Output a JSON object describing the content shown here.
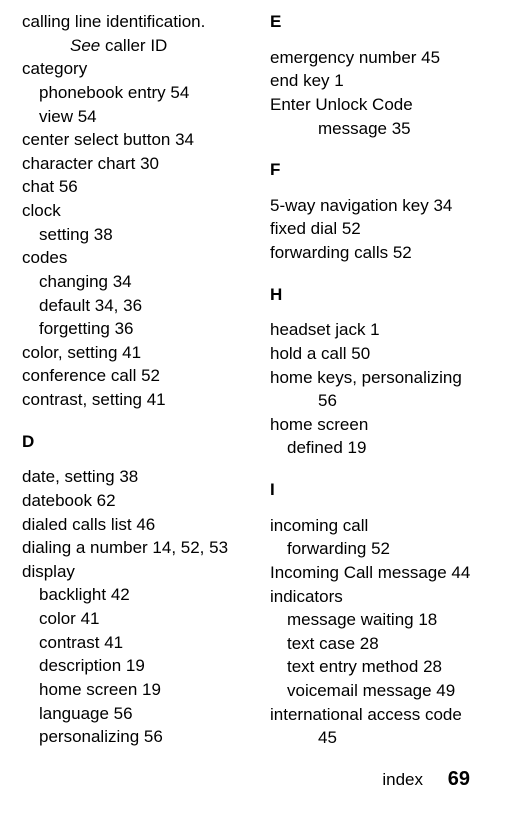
{
  "left": {
    "l01": "calling line identification.",
    "l02_prefix": "See",
    "l02_rest": " caller ID",
    "l03": "category",
    "l04": "phonebook entry  54",
    "l05": "view  54",
    "l06": "center select button  34",
    "l07": "character chart  30",
    "l08": "chat  56",
    "l09": "clock",
    "l10": "setting  38",
    "l11": "codes",
    "l12": "changing  34",
    "l13": "default  34, 36",
    "l14": "forgetting  36",
    "l15": "color, setting  41",
    "l16": "conference call  52",
    "l17": "contrast, setting  41",
    "sD": "D",
    "l18": "date, setting  38",
    "l19": "datebook  62",
    "l20": "dialed calls list  46",
    "l21": "dialing a number  14, 52, 53",
    "l22": "display",
    "l23": "backlight  42",
    "l24": "color  41",
    "l25": "contrast  41",
    "l26": "description  19",
    "l27": "home screen  19",
    "l28": "language  56",
    "l29": "personalizing  56"
  },
  "right": {
    "sE": "E",
    "r01": "emergency number  45",
    "r02": "end key  1",
    "r03": "Enter Unlock Code",
    "r04": "message  35",
    "sF": "F",
    "r05": "5-way navigation key  34",
    "r06": "fixed dial  52",
    "r07": "forwarding calls  52",
    "sH": "H",
    "r08": "headset jack  1",
    "r09": "hold a call  50",
    "r10": "home keys, personalizing",
    "r11": "56",
    "r12": "home screen",
    "r13": "defined  19",
    "sI": "I",
    "r14": "incoming call",
    "r15": "forwarding  52",
    "r16": "Incoming Call message  44",
    "r17": "indicators",
    "r18": "message waiting  18",
    "r19": "text case  28",
    "r20": "text entry method  28",
    "r21": "voicemail message  49",
    "r22": "international access code",
    "r23": "45"
  },
  "footer": {
    "label": "index",
    "page": "69"
  }
}
